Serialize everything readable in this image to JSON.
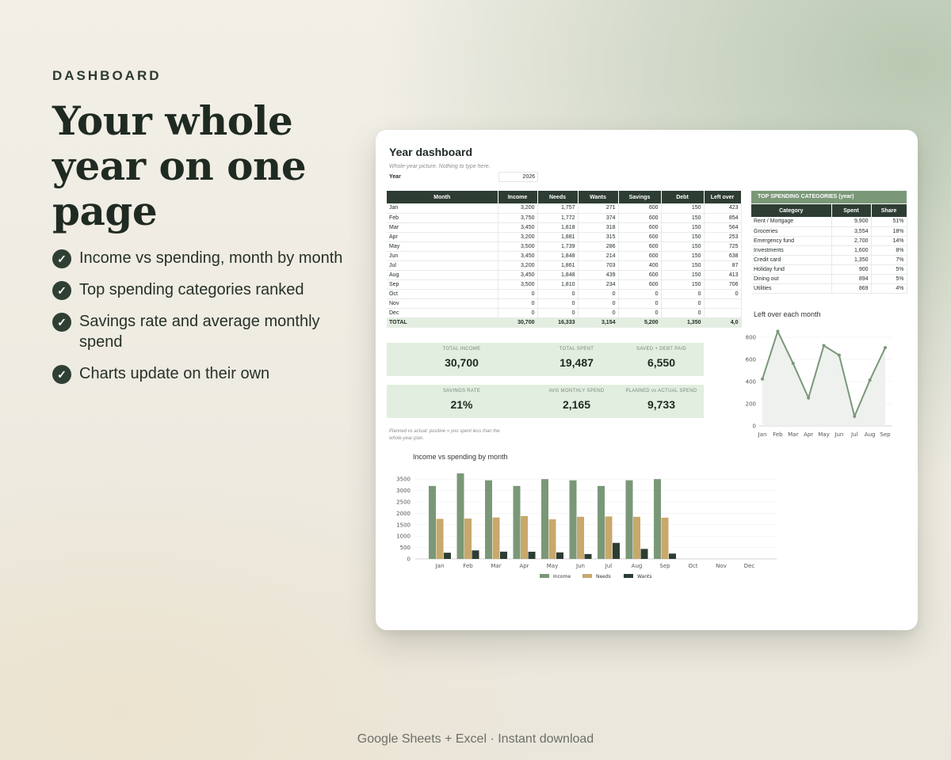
{
  "hero": {
    "eyebrow": "DASHBOARD",
    "headline": "Your whole year on one page",
    "features": [
      "Income vs spending, month by month",
      "Top spending categories ranked",
      "Savings rate and average monthly spend",
      "Charts update on their own"
    ]
  },
  "sheet": {
    "title": "Year dashboard",
    "subtitle": "Whole-year picture. Nothing to type here.",
    "year_label": "Year",
    "year_value": "2026",
    "columns": [
      "Month",
      "Income",
      "Needs",
      "Wants",
      "Savings",
      "Debt",
      "Left over"
    ],
    "rows": [
      [
        "Jan",
        "3,200",
        "1,757",
        "271",
        "600",
        "150",
        "423"
      ],
      [
        "Feb",
        "3,750",
        "1,772",
        "374",
        "600",
        "150",
        "854"
      ],
      [
        "Mar",
        "3,450",
        "1,818",
        "318",
        "600",
        "150",
        "564"
      ],
      [
        "Apr",
        "3,200",
        "1,881",
        "315",
        "600",
        "150",
        "253"
      ],
      [
        "May",
        "3,500",
        "1,739",
        "286",
        "600",
        "150",
        "725"
      ],
      [
        "Jun",
        "3,450",
        "1,848",
        "214",
        "600",
        "150",
        "638"
      ],
      [
        "Jul",
        "3,200",
        "1,861",
        "703",
        "400",
        "150",
        "87"
      ],
      [
        "Aug",
        "3,450",
        "1,848",
        "439",
        "600",
        "150",
        "413"
      ],
      [
        "Sep",
        "3,500",
        "1,810",
        "234",
        "600",
        "150",
        "706"
      ],
      [
        "Oct",
        "0",
        "0",
        "0",
        "0",
        "0",
        "0"
      ],
      [
        "Nov",
        "0",
        "0",
        "0",
        "0",
        "0",
        ""
      ],
      [
        "Dec",
        "0",
        "0",
        "0",
        "0",
        "0",
        ""
      ]
    ],
    "total": [
      "TOTAL",
      "30,700",
      "16,333",
      "3,154",
      "5,200",
      "1,350",
      "4,0"
    ],
    "categories_title": "TOP SPENDING CATEGORIES (year)",
    "category_columns": [
      "Category",
      "Spent",
      "Share"
    ],
    "categories": [
      [
        "Rent / Mortgage",
        "9,900",
        "51%"
      ],
      [
        "Groceries",
        "3,554",
        "18%"
      ],
      [
        "Emergency fund",
        "2,700",
        "14%"
      ],
      [
        "Investments",
        "1,600",
        "8%"
      ],
      [
        "Credit card",
        "1,350",
        "7%"
      ],
      [
        "Holiday fund",
        "900",
        "5%"
      ],
      [
        "Dining out",
        "894",
        "5%"
      ],
      [
        "Utilities",
        "869",
        "4%"
      ]
    ],
    "kpis_row1": [
      {
        "label": "TOTAL INCOME",
        "value": "30,700"
      },
      {
        "label": "TOTAL SPENT",
        "value": "19,487"
      },
      {
        "label": "SAVED + DEBT PAID",
        "value": "6,550"
      }
    ],
    "kpis_row2": [
      {
        "label": "SAVINGS RATE",
        "value": "21%"
      },
      {
        "label": "AVG MONTHLY SPEND",
        "value": "2,165"
      },
      {
        "label": "PLANNED vs ACTUAL SPEND",
        "value": "9,733"
      }
    ],
    "note": "Planned vs actual: positive = you spent less than the whole-year plan."
  },
  "chart_data": [
    {
      "type": "line",
      "title": "Left over each month",
      "x": [
        "Jan",
        "Feb",
        "Mar",
        "Apr",
        "May",
        "Jun",
        "Jul",
        "Aug",
        "Sep"
      ],
      "values": [
        423,
        854,
        564,
        253,
        725,
        638,
        87,
        413,
        706
      ],
      "ylim": [
        0,
        900
      ],
      "yticks": [
        0,
        200,
        400,
        600,
        800
      ],
      "grid": true,
      "color": "#7a9878"
    },
    {
      "type": "bar",
      "title": "Income vs spending by month",
      "categories": [
        "Jan",
        "Feb",
        "Mar",
        "Apr",
        "May",
        "Jun",
        "Jul",
        "Aug",
        "Sep",
        "Oct",
        "Nov",
        "Dec"
      ],
      "series": [
        {
          "name": "Income",
          "color": "#7a9878",
          "values": [
            3200,
            3750,
            3450,
            3200,
            3500,
            3450,
            3200,
            3450,
            3500,
            0,
            0,
            0
          ]
        },
        {
          "name": "Needs",
          "color": "#c8a86b",
          "values": [
            1757,
            1772,
            1818,
            1881,
            1739,
            1848,
            1861,
            1848,
            1810,
            0,
            0,
            0
          ]
        },
        {
          "name": "Wants",
          "color": "#2e3d33",
          "values": [
            271,
            374,
            318,
            315,
            286,
            214,
            703,
            439,
            234,
            0,
            0,
            0
          ]
        }
      ],
      "ylim": [
        0,
        3750
      ],
      "yticks": [
        0,
        500,
        1000,
        1500,
        2000,
        2500,
        3000,
        3500
      ],
      "grid": true,
      "legend": "bottom"
    }
  ],
  "footer": {
    "text": "Google Sheets + Excel  ·  Instant download"
  }
}
